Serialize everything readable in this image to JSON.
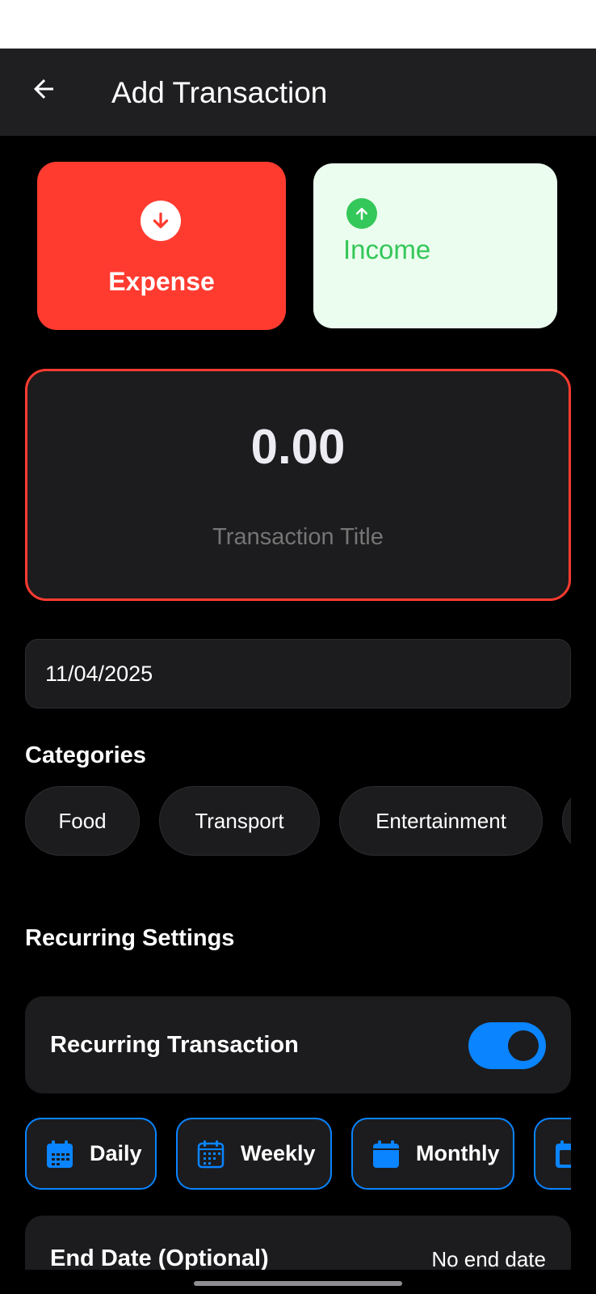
{
  "header": {
    "title": "Add Transaction",
    "back_icon": "arrow-left-icon"
  },
  "type_selector": {
    "expense": {
      "label": "Expense",
      "icon": "arrow-down-circle-icon",
      "color": "#ff3b30",
      "selected": true
    },
    "income": {
      "label": "Income",
      "icon": "arrow-up-circle-icon",
      "color": "#34c759",
      "selected": false
    }
  },
  "amount": {
    "value": "0.00",
    "title_placeholder": "Transaction Title"
  },
  "date": {
    "value": "11/04/2025"
  },
  "categories": {
    "title": "Categories",
    "items": [
      "Food",
      "Transport",
      "Entertainment"
    ]
  },
  "recurring": {
    "section_title": "Recurring Settings",
    "toggle_label": "Recurring Transaction",
    "toggle_on": true,
    "accent": "#0a84ff",
    "frequencies": [
      {
        "label": "Daily",
        "icon": "calendar-grid-icon",
        "selected": false
      },
      {
        "label": "Weekly",
        "icon": "calendar-grid-icon",
        "selected": false
      },
      {
        "label": "Monthly",
        "icon": "calendar-icon",
        "selected": false
      },
      {
        "label": "",
        "icon": "calendar-number-icon",
        "selected": false
      }
    ]
  },
  "end_date": {
    "label": "End Date (Optional)",
    "value": "No end date"
  }
}
